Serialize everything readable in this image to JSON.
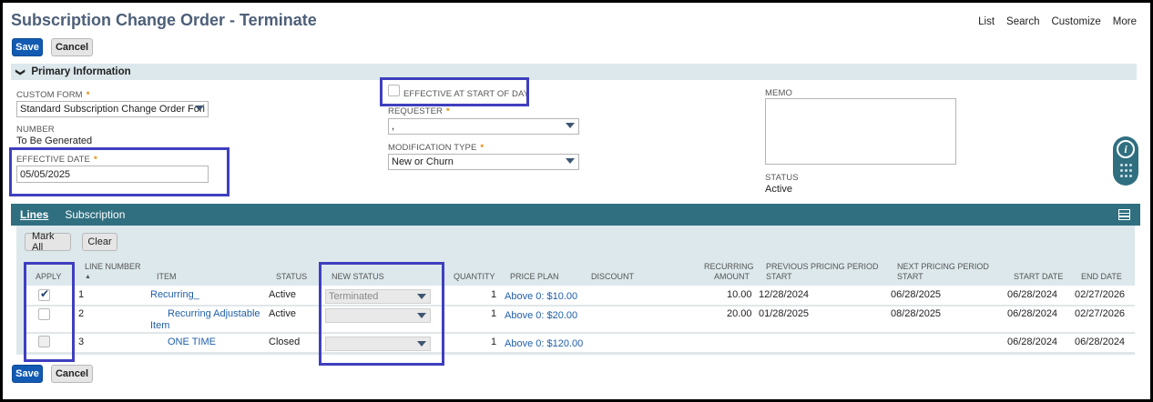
{
  "header": {
    "title": "Subscription Change Order - Terminate",
    "links": [
      "List",
      "Search",
      "Customize",
      "More"
    ]
  },
  "toolbar": {
    "save_label": "Save",
    "cancel_label": "Cancel"
  },
  "section": {
    "label": "Primary Information"
  },
  "fields": {
    "custom_form": {
      "label": "CUSTOM FORM",
      "value": "Standard Subscription Change Order Fori"
    },
    "number": {
      "label": "NUMBER",
      "value": "To Be Generated"
    },
    "effective_date": {
      "label": "EFFECTIVE DATE",
      "value": "05/05/2025"
    },
    "effective_start": {
      "label": "EFFECTIVE AT START OF DAY",
      "checked": false
    },
    "requester": {
      "label": "REQUESTER",
      "value": ","
    },
    "modification_type": {
      "label": "MODIFICATION TYPE",
      "value": "New or Churn"
    },
    "memo": {
      "label": "MEMO",
      "value": ""
    },
    "status": {
      "label": "STATUS",
      "value": "Active"
    }
  },
  "tabs": {
    "lines": "Lines",
    "subscription": "Subscription"
  },
  "lines_toolbar": {
    "mark_all": "Mark All",
    "clear": "Clear"
  },
  "columns": {
    "apply": "APPLY",
    "line_number": "LINE NUMBER",
    "line_number_sort": "▲",
    "item": "ITEM",
    "status": "STATUS",
    "new_status": "NEW STATUS",
    "quantity": "QUANTITY",
    "price_plan": "PRICE PLAN",
    "discount": "DISCOUNT",
    "recurring_amount_1": "RECURRING",
    "recurring_amount_2": "AMOUNT",
    "prev_period_1": "PREVIOUS PRICING PERIOD",
    "prev_period_2": "START",
    "next_period_1": "NEXT PRICING PERIOD",
    "next_period_2": "START",
    "start_date": "START DATE",
    "end_date": "END DATE"
  },
  "rows": [
    {
      "apply": true,
      "line": "1",
      "item_1": "Recurring_",
      "item_2": "",
      "status": "Active",
      "new_status": "Terminated",
      "quantity": "1",
      "price_plan": "Above 0:  $10.00",
      "discount": "",
      "recurring_amount": "10.00",
      "prev_start": "12/28/2024",
      "next_start": "06/28/2025",
      "start_date": "06/28/2024",
      "end_date": "02/27/2026"
    },
    {
      "apply": false,
      "line": "2",
      "item_1": "Recurring Adjustable",
      "item_2": "Item",
      "status": "Active",
      "new_status": "",
      "quantity": "1",
      "price_plan": "Above 0:  $20.00",
      "discount": "",
      "recurring_amount": "20.00",
      "prev_start": "01/28/2025",
      "next_start": "08/28/2025",
      "start_date": "06/28/2024",
      "end_date": "02/27/2026"
    },
    {
      "apply": false,
      "line": "3",
      "item_1": "ONE TIME",
      "item_2": "",
      "status": "Closed",
      "new_status": "",
      "quantity": "1",
      "price_plan": "Above 0: $120.00",
      "discount": "",
      "recurring_amount": "",
      "prev_start": "",
      "next_start": "",
      "start_date": "06/28/2024",
      "end_date": "06/28/2024"
    }
  ],
  "colors": {
    "primary": "#125ab2",
    "tabbar": "#2f6f80",
    "highlight": "#3f3fbf",
    "section": "#dce8ec"
  }
}
